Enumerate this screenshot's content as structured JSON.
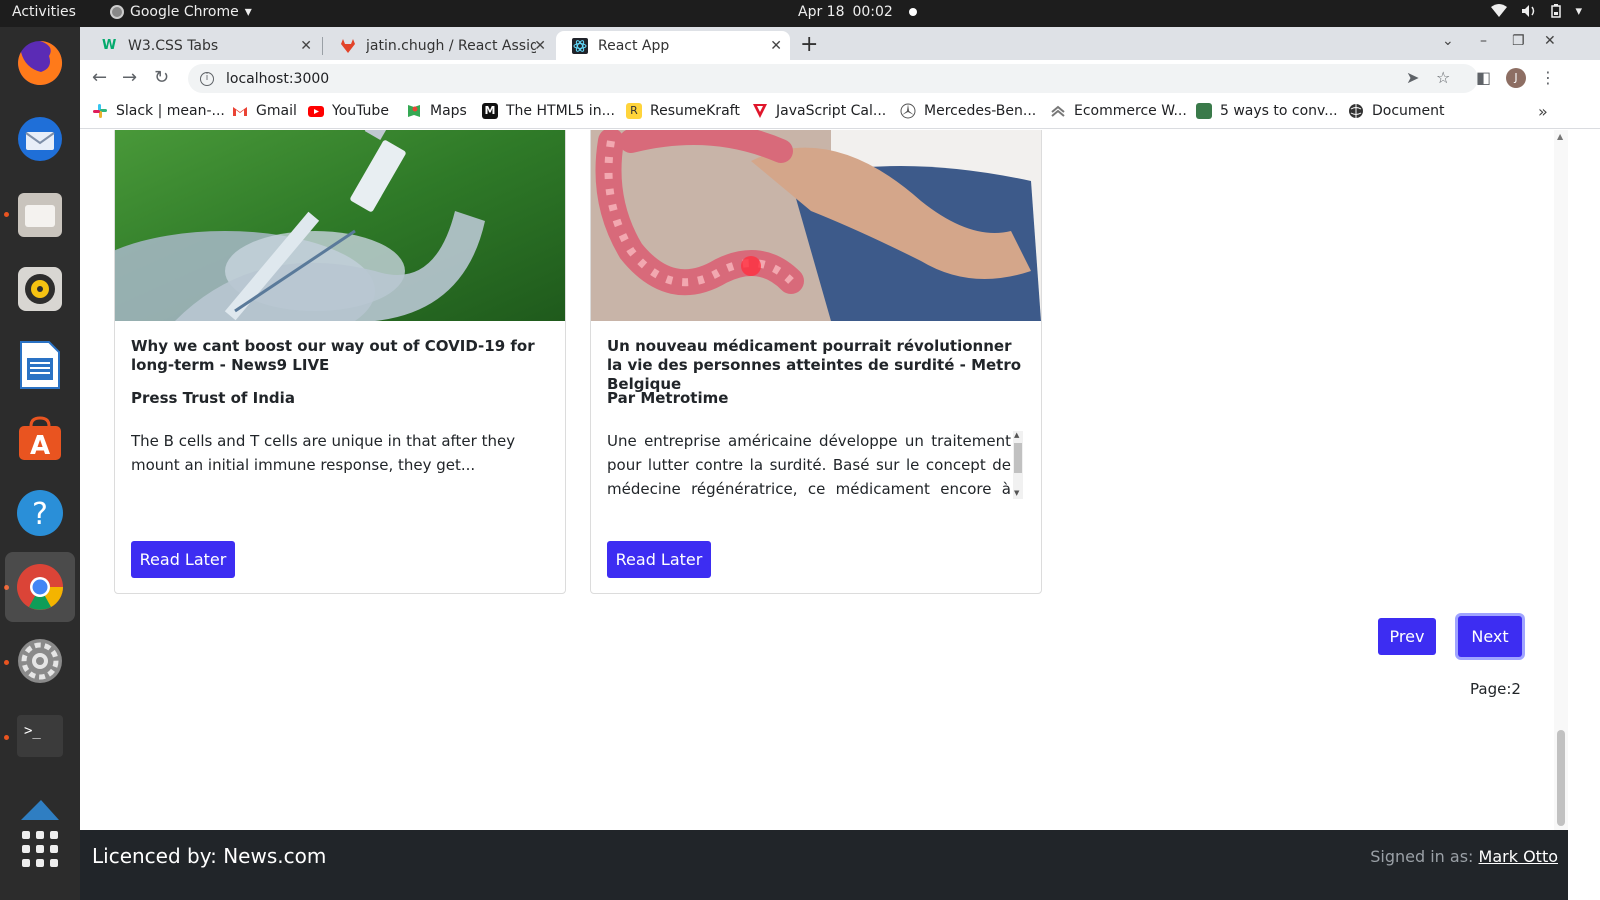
{
  "topbar": {
    "activities": "Activities",
    "app_name": "Google Chrome",
    "date": "Apr 18",
    "time": "00:02"
  },
  "dock": {
    "apps": [
      "firefox",
      "thunderbird",
      "files",
      "rhythmbox",
      "writer",
      "software",
      "help",
      "chrome",
      "settings",
      "terminal",
      "vscode",
      "show-apps"
    ]
  },
  "browser": {
    "tabs": [
      {
        "title": "W3.CSS Tabs",
        "active": false
      },
      {
        "title": "jatin.chugh / React Assign",
        "active": false
      },
      {
        "title": "React App",
        "active": true
      }
    ],
    "url": "localhost:3000",
    "profile_initial": "J",
    "bookmarks": [
      "Slack | mean-...",
      "Gmail",
      "YouTube",
      "Maps",
      "The HTML5 in...",
      "ResumeKraft",
      "JavaScript Cal...",
      "Mercedes-Ben...",
      "Ecommerce W...",
      "5 ways to conv...",
      "Document"
    ]
  },
  "articles": [
    {
      "title": "Why we cant boost our way out of COVID-19 for long-term - News9 LIVE",
      "source": "Press Trust of India",
      "description": "The B cells and T cells are unique in that after they mount an initial immune response, they get...",
      "button": "Read Later"
    },
    {
      "title": "Un nouveau médicament pourrait révolutionner la vie des personnes atteintes de surdité - Metro Belgique",
      "source": "Par Metrotime",
      "description": "Une entreprise américaine développe un traitement pour lutter contre la surdité. Basé sur le concept de médecine régénératrice, ce médicament encore à l'essai",
      "button": "Read Later"
    }
  ],
  "pagination": {
    "prev": "Prev",
    "next": "Next",
    "page_label": "Page:2"
  },
  "footer": {
    "licence": "Licenced by: News.com",
    "signed_prefix": "Signed in as:",
    "user": "Mark Otto"
  },
  "colors": {
    "primary_button": "#3d2df2",
    "footer_bg": "#212529"
  }
}
